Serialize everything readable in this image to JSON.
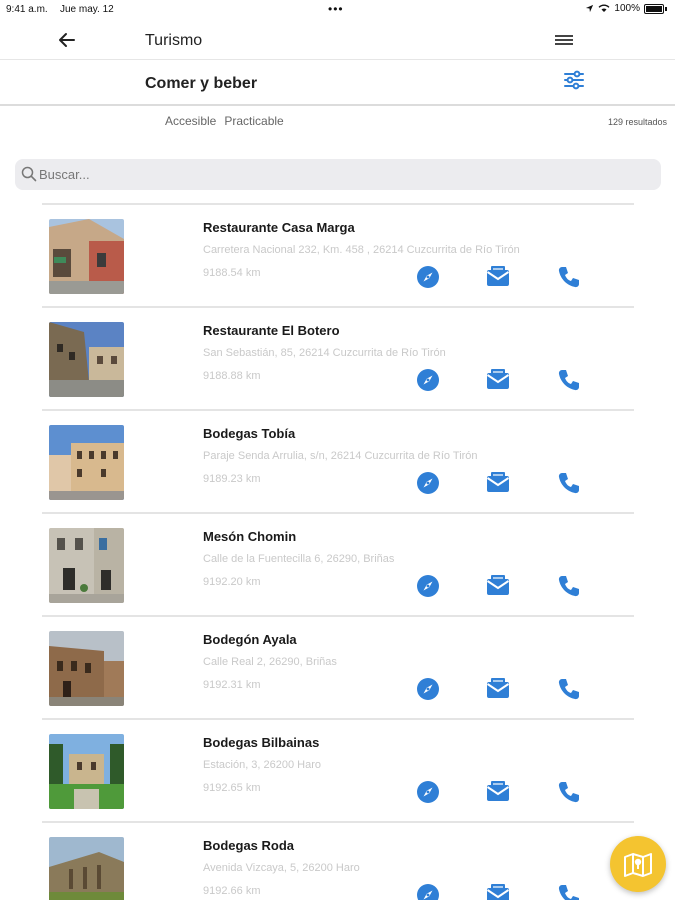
{
  "status_bar": {
    "time": "9:41 a.m.",
    "date": "Jue may. 12",
    "battery": "100%"
  },
  "nav": {
    "title": "Turismo",
    "back_icon": "arrow-left-icon",
    "menu_icon": "hamburger-icon"
  },
  "section": {
    "title": "Comer y beber",
    "filter_icon": "sliders-icon"
  },
  "filters": {
    "chips": [
      "Accesible",
      "Practicable"
    ],
    "results": "129 resultados"
  },
  "search": {
    "placeholder": "Buscar..."
  },
  "colors": {
    "accent": "#2f7fd6",
    "fab": "#f4c430",
    "divider": "#e4e4e4"
  },
  "items": [
    {
      "name": "Restaurante Casa Marga",
      "address": "Carretera Nacional 232, Km. 458 , 26214 Cuzcurrita de Río Tirón",
      "distance": "9188.54 km"
    },
    {
      "name": "Restaurante El Botero",
      "address": "San Sebastián, 85, 26214 Cuzcurrita de Río Tirón",
      "distance": "9188.88 km"
    },
    {
      "name": "Bodegas Tobía",
      "address": "Paraje Senda Arrulia, s/n, 26214 Cuzcurrita de Río Tirón",
      "distance": "9189.23 km"
    },
    {
      "name": "Mesón Chomin",
      "address": "Calle de la Fuentecilla 6, 26290, Briñas",
      "distance": "9192.20 km"
    },
    {
      "name": "Bodegón Ayala",
      "address": "Calle Real 2, 26290, Briñas",
      "distance": "9192.31 km"
    },
    {
      "name": "Bodegas Bilbainas",
      "address": "Estación, 3, 26200 Haro",
      "distance": "9192.65 km"
    },
    {
      "name": "Bodegas Roda",
      "address": "Avenida Vizcaya, 5, 26200 Haro",
      "distance": "9192.66 km"
    }
  ]
}
